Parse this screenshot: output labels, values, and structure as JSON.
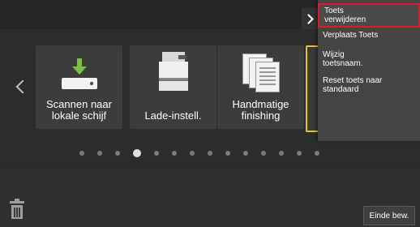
{
  "tiles": [
    {
      "label_line1": "Scannen naar",
      "label_line2": "lokale schijf",
      "icon": "scan-to-drive-icon"
    },
    {
      "label_line1": "Lade-instell.",
      "label_line2": "",
      "icon": "printer-tray-icon"
    },
    {
      "label_line1": "Handmatige",
      "label_line2": "finishing",
      "icon": "documents-stack-icon"
    }
  ],
  "pager": {
    "count": 14,
    "active_index": 3
  },
  "context_menu": {
    "items": [
      {
        "label_line1": "Toets",
        "label_line2": "verwijderen",
        "selected": true
      },
      {
        "label_line1": "Verplaats Toets",
        "label_line2": ""
      },
      {
        "label_line1": "Wijzig",
        "label_line2": "toetsnaam."
      },
      {
        "label_line1": "Reset toets naar standaard",
        "label_line2": ""
      }
    ]
  },
  "footer": {
    "done_label": "Einde bew."
  },
  "colors": {
    "selection_border": "#d81e2b",
    "highlight_border": "#e2c23b",
    "download_arrow": "#7bc043"
  }
}
